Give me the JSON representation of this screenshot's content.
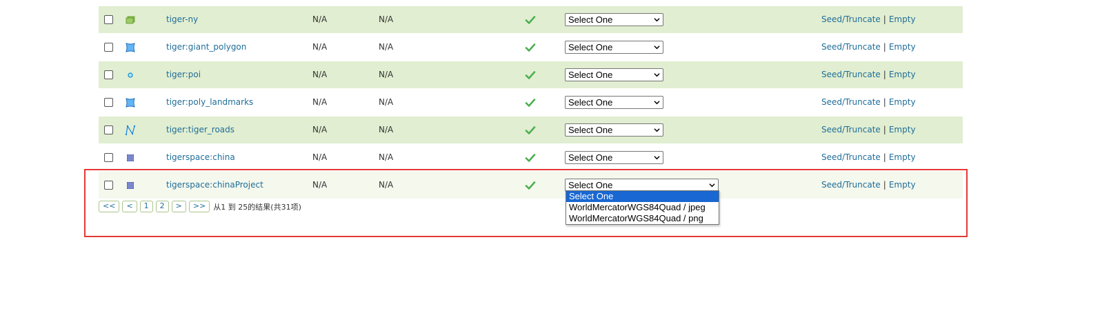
{
  "rows": [
    {
      "name": "tiger-ny",
      "icon": "layer-group-icon",
      "col3": "N/A",
      "col4": "N/A",
      "select": "Select One",
      "seed": "Seed/Truncate",
      "sep": "|",
      "empty": "Empty"
    },
    {
      "name": "tiger:giant_polygon",
      "icon": "polygon-icon",
      "col3": "N/A",
      "col4": "N/A",
      "select": "Select One",
      "seed": "Seed/Truncate",
      "sep": "|",
      "empty": "Empty"
    },
    {
      "name": "tiger:poi",
      "icon": "point-icon",
      "col3": "N/A",
      "col4": "N/A",
      "select": "Select One",
      "seed": "Seed/Truncate",
      "sep": "|",
      "empty": "Empty"
    },
    {
      "name": "tiger:poly_landmarks",
      "icon": "polygon-icon",
      "col3": "N/A",
      "col4": "N/A",
      "select": "Select One",
      "seed": "Seed/Truncate",
      "sep": "|",
      "empty": "Empty"
    },
    {
      "name": "tiger:tiger_roads",
      "icon": "line-icon",
      "col3": "N/A",
      "col4": "N/A",
      "select": "Select One",
      "seed": "Seed/Truncate",
      "sep": "|",
      "empty": "Empty"
    },
    {
      "name": "tigerspace:china",
      "icon": "raster-icon",
      "col3": "N/A",
      "col4": "N/A",
      "select": "Select One",
      "seed": "Seed/Truncate",
      "sep": "|",
      "empty": "Empty"
    },
    {
      "name": "tigerspace:chinaProject",
      "icon": "raster-icon",
      "col3": "N/A",
      "col4": "N/A",
      "select": "Select One",
      "seed": "Seed/Truncate",
      "sep": "|",
      "empty": "Empty"
    }
  ],
  "pager": {
    "first": "<<",
    "prev": "<",
    "page1": "1",
    "page2": "2",
    "next": ">",
    "last": ">>",
    "summary": "从1 到 25的结果(共31项)"
  },
  "dropdown": {
    "options": [
      "Select One",
      "WorldMercatorWGS84Quad / jpeg",
      "WorldMercatorWGS84Quad / png"
    ],
    "selected_index": 0
  },
  "colors": {
    "row_alt": "#e1eed1",
    "link": "#1f6d99",
    "check": "#4caf50",
    "selected_option": "#1967d2",
    "highlight_frame": "#e53935"
  }
}
